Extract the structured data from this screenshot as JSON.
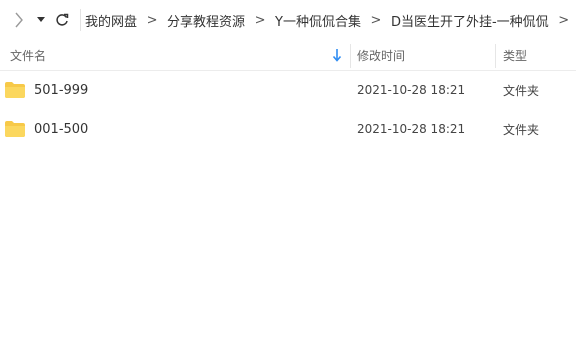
{
  "breadcrumb": {
    "items": [
      "我的网盘",
      "分享教程资源",
      "Y一种侃侃合集",
      "D当医生开了外挂-一种侃侃"
    ],
    "separator": ">",
    "trailing": ">"
  },
  "columns": {
    "name": "文件名",
    "date": "修改时间",
    "type": "类型"
  },
  "files": [
    {
      "name": "501-999",
      "modified": "2021-10-28 18:21",
      "type": "文件夹"
    },
    {
      "name": "001-500",
      "modified": "2021-10-28 18:21",
      "type": "文件夹"
    }
  ],
  "colors": {
    "folder": "#f7c948",
    "sort_arrow": "#2f8cf2"
  },
  "icons": [
    "forward-icon",
    "dropdown-icon",
    "refresh-icon",
    "sort-down-icon",
    "folder-icon"
  ]
}
